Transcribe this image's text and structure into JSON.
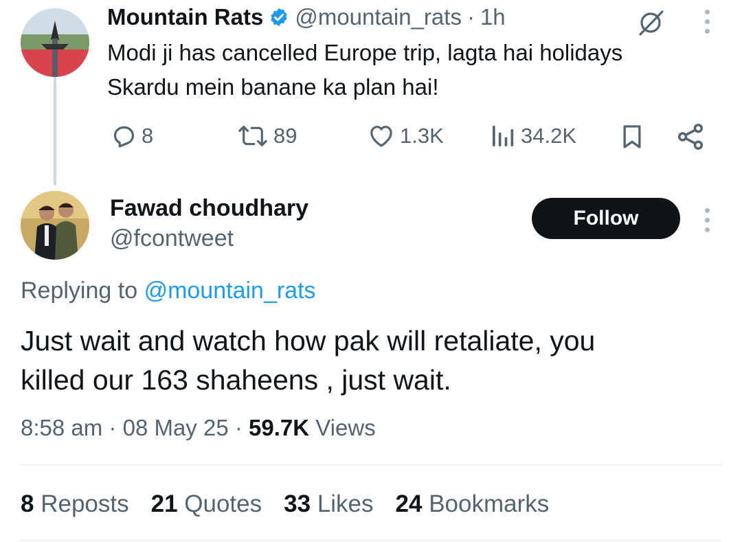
{
  "quoted_tweet": {
    "author_name": "Mountain Rats",
    "author_handle": "@mountain_rats",
    "separator": "·",
    "time_ago": "1h",
    "text_line1": "Modi ji has cancelled Europe trip, lagta hai holidays",
    "text_line2": "Skardu mein banane ka plan hai!",
    "replies": "8",
    "reposts": "89",
    "likes": "1.3K",
    "views": "34.2K"
  },
  "reply_tweet": {
    "author_name": "Fawad choudhary",
    "author_handle": "@fcontweet",
    "follow_label": "Follow",
    "replying_prefix": "Replying to",
    "replying_to": "@mountain_rats",
    "text_line1": "Just wait and watch how pak will retaliate, you",
    "text_line2": "killed our 163 shaheens , just wait.",
    "time": "8:58 am",
    "sep1": "·",
    "date": "08 May 25",
    "sep2": "·",
    "views_count": "59.7K",
    "views_label": "Views"
  },
  "stats": {
    "reposts_count": "8",
    "reposts_label": "Reposts",
    "quotes_count": "21",
    "quotes_label": "Quotes",
    "likes_count": "33",
    "likes_label": "Likes",
    "bookmarks_count": "24",
    "bookmarks_label": "Bookmarks"
  },
  "colors": {
    "text_primary": "#0f1419",
    "text_secondary": "#536471",
    "link": "#1d9bf0",
    "verified": "#1d9bf0",
    "follow_button_bg": "#0f1419"
  },
  "icons": [
    "verified-badge-icon",
    "grok-icon",
    "more-icon",
    "reply-icon",
    "repost-icon",
    "like-icon",
    "views-icon",
    "bookmark-icon",
    "share-icon"
  ]
}
